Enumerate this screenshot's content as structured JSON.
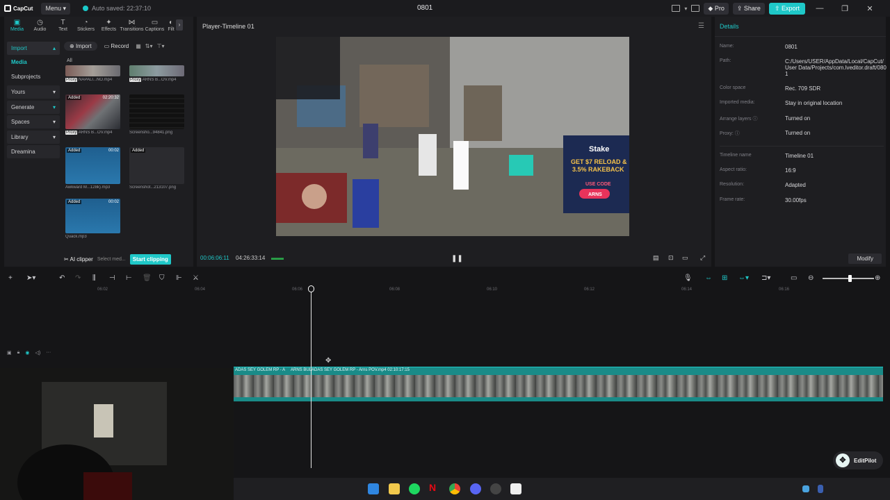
{
  "titlebar": {
    "app_name": "CapCut",
    "menu_label": "Menu",
    "autosave_text": "Auto saved: 22:37:10",
    "project_title": "0801",
    "pro_label": "Pro",
    "share_label": "Share",
    "export_label": "Export"
  },
  "tool_tabs": [
    {
      "label": "Media",
      "icon": "media-icon"
    },
    {
      "label": "Audio",
      "icon": "audio-icon"
    },
    {
      "label": "Text",
      "icon": "text-icon"
    },
    {
      "label": "Stickers",
      "icon": "stickers-icon"
    },
    {
      "label": "Effects",
      "icon": "effects-icon"
    },
    {
      "label": "Transitions",
      "icon": "transitions-icon"
    },
    {
      "label": "Captions",
      "icon": "captions-icon"
    },
    {
      "label": "Filt",
      "icon": "filters-icon"
    }
  ],
  "side_nav": {
    "import": "Import",
    "media": "Media",
    "subprojects": "Subprojects",
    "yours": "Yours",
    "generate": "Generate",
    "spaces": "Spaces",
    "library": "Library",
    "dreamina": "Dreamina"
  },
  "media_toolbar": {
    "import_label": "Import",
    "record_label": "Record",
    "all_label": "All"
  },
  "media_items": [
    {
      "name": "NAPALI...NO.mp4",
      "badge": "",
      "duration": "",
      "proxy": "Proxy"
    },
    {
      "name": "ARNS B...OV.mp4",
      "badge": "",
      "duration": "",
      "proxy": "Proxy"
    },
    {
      "name": "ARNS B...OV.mp4",
      "badge": "Added",
      "duration": "02:20:32",
      "proxy": "Proxy"
    },
    {
      "name": "Screensho...94841.png",
      "badge": "",
      "duration": "",
      "proxy": ""
    },
    {
      "name": "Awkward M...128k).mp3",
      "badge": "Added",
      "duration": "00:02",
      "proxy": ""
    },
    {
      "name": "Screenshot...213107.png",
      "badge": "Added",
      "duration": "",
      "proxy": ""
    },
    {
      "name": "Quack.mp3",
      "badge": "Added",
      "duration": "00:02",
      "proxy": ""
    }
  ],
  "ai_bar": {
    "ai_clipper": "AI clipper",
    "select_text": "Select med...",
    "start_clipping": "Start clipping"
  },
  "player": {
    "title": "Player-Timeline 01",
    "current_time": "00:06:06:11",
    "total_time": "04:26:33:14"
  },
  "video_overlay": {
    "promo_brand": "Stake",
    "promo_line1": "GET $7 RELOAD &",
    "promo_line2": "3.5% RAKEBACK",
    "promo_code_label": "USE CODE",
    "promo_code": "ARNS"
  },
  "details": {
    "header": "Details",
    "rows": [
      {
        "key": "Name:",
        "value": "0801"
      },
      {
        "key": "Path:",
        "value": "C:/Users/USER/AppData/Local/CapCut/User Data/Projects/com.lveditor.draft/0801"
      },
      {
        "key": "Color space",
        "value": "Rec. 709 SDR"
      },
      {
        "key": "Imported media:",
        "value": "Stay in original location"
      },
      {
        "key": "Arrange layers",
        "value": "Turned on"
      },
      {
        "key": "Proxy:",
        "value": "Turned on"
      },
      {
        "key": "Timeline name",
        "value": "Timeline 01"
      },
      {
        "key": "Aspect ratio:",
        "value": "16:9"
      },
      {
        "key": "Resolution:",
        "value": "Adapted"
      },
      {
        "key": "Frame rate:",
        "value": "30.00fps"
      }
    ],
    "modify_label": "Modify"
  },
  "timeline": {
    "ticks": [
      "06:02",
      "06:04",
      "06:06",
      "06:08",
      "06:10",
      "06:12",
      "06:14",
      "06:16"
    ],
    "clip_label_1": "ADAS SEY GOLEM RP - A",
    "clip_label_2": "ARNS BULADAS SEY GOLEM RP - Arns POV.mp4   02:10:17:15"
  },
  "editpilot_label": "EditPilot",
  "colors": {
    "accent": "#1fc8c8",
    "background": "#151517",
    "panel": "#1e1e21"
  }
}
